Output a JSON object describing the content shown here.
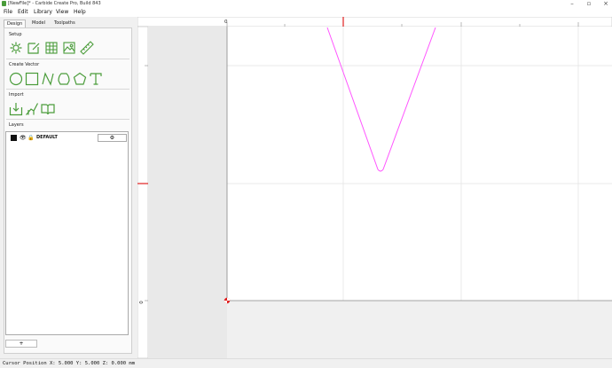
{
  "window": {
    "title": "[NewFile]* - Carbide Create Pro, Build 843"
  },
  "menu": [
    "File",
    "Edit",
    "Library",
    "View",
    "Help"
  ],
  "tabs": [
    "Design",
    "Model",
    "Toolpaths"
  ],
  "sections": {
    "setup": "Setup",
    "create_vector": "Create Vector",
    "import": "Import",
    "layers": "Layers"
  },
  "tool_icons": {
    "setup": [
      "gear-icon",
      "edit-document-icon",
      "grid-icon",
      "image-icon",
      "ruler-icon"
    ],
    "create_vector": [
      "circle-icon",
      "rectangle-icon",
      "curve-icon",
      "polygon-icon",
      "pentagon-icon",
      "text-icon"
    ],
    "import": [
      "import-icon",
      "trace-icon",
      "library-icon"
    ]
  },
  "layers": [
    {
      "name": "DEFAULT",
      "color": "#000000",
      "visible": true,
      "locked": true
    }
  ],
  "add_layer_label": "+",
  "gear_glyph": "⚙",
  "ruler": {
    "top_zero": "0",
    "left_zero": "0"
  },
  "status": "Cursor Position X: 5.000 Y: 5.000 Z: 0.000 mm",
  "colors": {
    "accent": "#4a9c3a",
    "vector": "#ff55ff",
    "origin": "#e02020"
  }
}
